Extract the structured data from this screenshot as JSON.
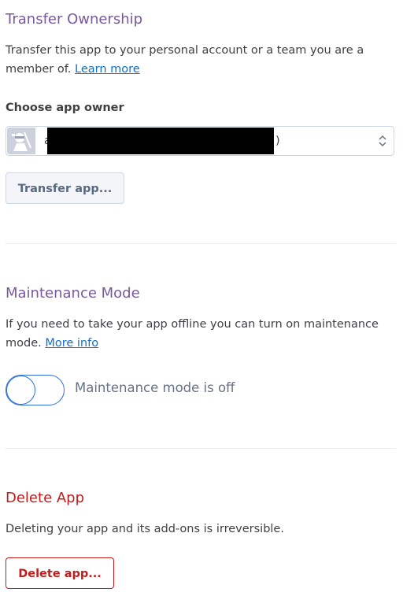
{
  "transfer": {
    "title": "Transfer Ownership",
    "description": "Transfer this app to your personal account or a team you are a member of.",
    "learn_more": "Learn more",
    "owner_label": "Choose app owner",
    "selected_owner_prefix": "a",
    "selected_owner_suffix": ")",
    "button_label": "Transfer app..."
  },
  "maintenance": {
    "title": "Maintenance Mode",
    "description": "If you need to take your app offline you can turn on maintenance mode.",
    "more_info": "More info",
    "toggle_state": "off",
    "toggle_label": "Maintenance mode is off"
  },
  "delete": {
    "title": "Delete App",
    "description": "Deleting your app and its add-ons is irreversible.",
    "button_label": "Delete app..."
  },
  "colors": {
    "section_title": "#79589f",
    "danger": "#c21b1b",
    "link": "#0f6fd0",
    "toggle_border": "#2f6fd6"
  },
  "icons": {
    "avatar": "ninja-avatar-icon",
    "select_chevrons": "chevron-up-down-icon"
  }
}
